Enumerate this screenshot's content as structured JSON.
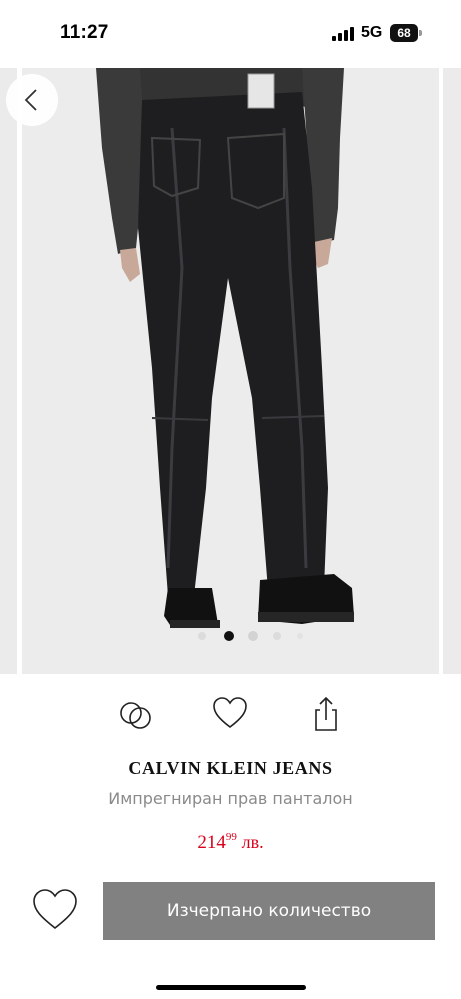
{
  "status_bar": {
    "time": "11:27",
    "network": "5G",
    "battery": "68"
  },
  "gallery": {
    "back_icon": "chevron-left-icon",
    "image_description": "product photo",
    "dot_count": 5,
    "active_dot_index": 1
  },
  "actions": {
    "compare_icon": "compare-circles-icon",
    "wishlist_icon": "heart-icon",
    "share_icon": "share-icon"
  },
  "product": {
    "brand": "CALVIN KLEIN JEANS",
    "name": "Импрегниран прав панталон",
    "price_main": "214",
    "price_cents": "99",
    "price_currency": "лв."
  },
  "bottom_bar": {
    "favorite_icon": "heart-icon",
    "buy_label": "Изчерпано количество"
  },
  "colors": {
    "price": "#d9001b",
    "button": "#818181",
    "muted_text": "#8a8a8a"
  }
}
